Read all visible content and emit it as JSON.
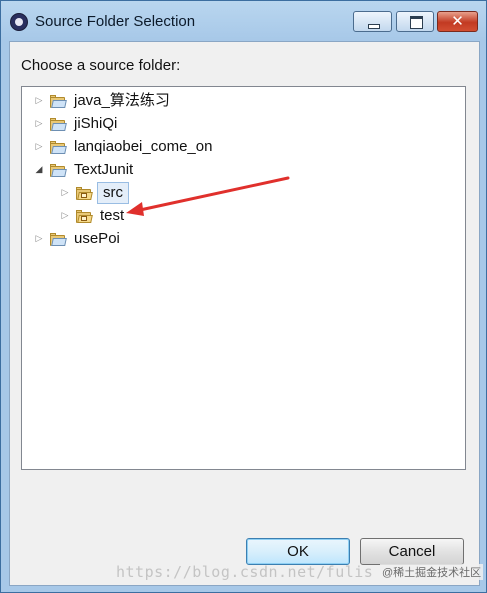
{
  "window": {
    "title": "Source Folder Selection",
    "controls": {
      "minimize": "minimize",
      "maximize": "maximize",
      "close": "✕"
    }
  },
  "prompt": "Choose a source folder:",
  "tree": {
    "items": [
      {
        "label": "java_算法练习",
        "expander": "▷",
        "icon": "project-folder-icon"
      },
      {
        "label": "jiShiQi",
        "expander": "▷",
        "icon": "project-folder-icon"
      },
      {
        "label": "lanqiaobei_come_on",
        "expander": "▷",
        "icon": "project-folder-icon"
      },
      {
        "label": "TextJunit",
        "expander": "◢",
        "icon": "project-folder-icon",
        "children": [
          {
            "label": "src",
            "expander": "▷",
            "icon": "package-folder-icon",
            "selected": true
          },
          {
            "label": "test",
            "expander": "▷",
            "icon": "package-folder-icon"
          }
        ]
      },
      {
        "label": "usePoi",
        "expander": "▷",
        "icon": "project-folder-icon"
      }
    ]
  },
  "buttons": {
    "ok": "OK",
    "cancel": "Cancel"
  },
  "annotation": {
    "color": "#e0302c",
    "points_to": "test"
  },
  "watermark": {
    "url": "https://blog.csdn.net/fulis",
    "badge": "@稀土掘金技术社区"
  }
}
